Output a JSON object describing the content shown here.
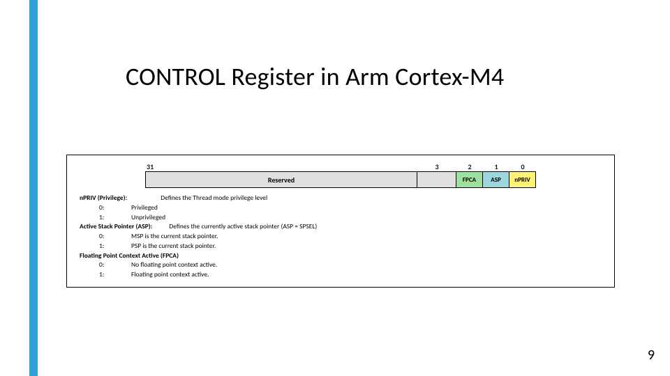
{
  "title": "CONTROL Register in Arm Cortex-M4",
  "register": {
    "bit31": "31",
    "bit3": "3",
    "bit2": "2",
    "bit1": "1",
    "bit0": "0",
    "reserved": "Reserved",
    "fpca": "FPCA",
    "asp": "ASP",
    "npriv": "nPRIV"
  },
  "desc": {
    "npriv_label": "nPRIV (Privilege):",
    "npriv_def": "Defines the Thread mode privilege level",
    "npriv_0k": "0:",
    "npriv_0v": "Privileged",
    "npriv_1k": "1:",
    "npriv_1v": "Unprivileged",
    "asp_label": "Active Stack Pointer (ASP):",
    "asp_def": "Defines the currently active stack pointer (ASP = SPSEL)",
    "asp_0k": "0:",
    "asp_0v": "MSP is the current stack pointer.",
    "asp_1k": "1:",
    "asp_1v": "PSP is the current stack pointer.",
    "fpca_label": "Floating Point Context Active (FPCA)",
    "fpca_0k": "0:",
    "fpca_0v": "No floating point context active.",
    "fpca_1k": "1:",
    "fpca_1v": "Floating point context active."
  },
  "page": "9"
}
